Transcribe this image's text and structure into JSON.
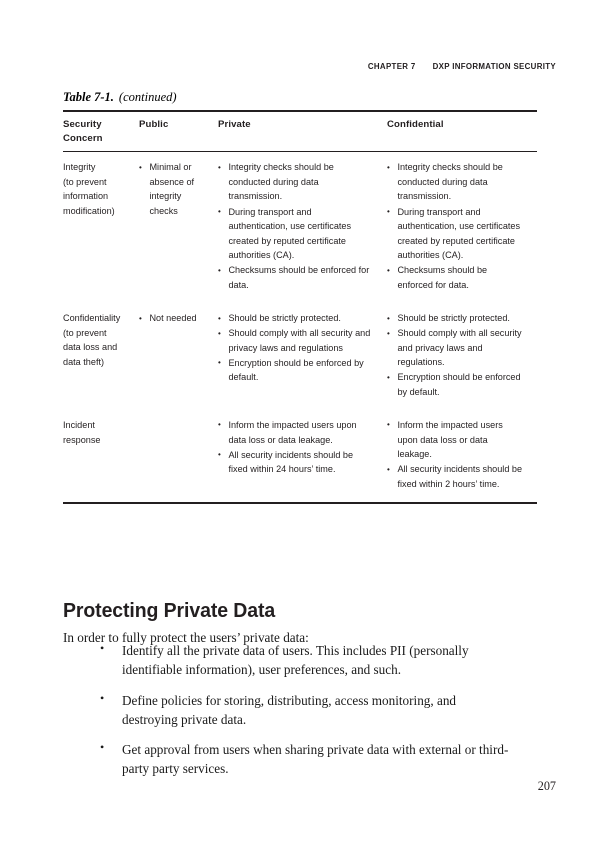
{
  "running_head": {
    "chapter": "CHAPTER 7",
    "title": "DXP INFORMATION SECURITY"
  },
  "table": {
    "caption_number": "Table 7-1.",
    "caption_continued": "(continued)",
    "columns": [
      {
        "label": "Security\nConcern",
        "line1": "Security",
        "line2": "Concern"
      },
      {
        "label": "Public"
      },
      {
        "label": "Private"
      },
      {
        "label": "Confidential"
      }
    ],
    "rows": [
      {
        "concern_lines": [
          "Integrity",
          "(to prevent",
          "information",
          "modification)"
        ],
        "public": [
          "Minimal or absence of integrity checks"
        ],
        "private": [
          "Integrity checks should be conducted during data transmission.",
          "During transport and authentication, use certificates created by reputed certificate authorities (CA).",
          "Checksums should be enforced for data."
        ],
        "confidential": [
          "Integrity checks should be conducted during data transmission.",
          "During transport and authentication, use certificates created by reputed certificate authorities (CA).",
          "Checksums should be enforced for data."
        ]
      },
      {
        "concern_lines": [
          "Confidentiality",
          "(to prevent",
          "data loss and",
          "data theft)"
        ],
        "public": [
          "Not needed"
        ],
        "private": [
          "Should be strictly protected.",
          "Should comply with all security and privacy laws and regulations",
          "Encryption should be enforced by default."
        ],
        "confidential": [
          "Should be strictly protected.",
          "Should comply with all security and privacy laws and regulations.",
          "Encryption should be enforced by default."
        ]
      },
      {
        "concern_lines": [
          "Incident",
          "response"
        ],
        "public": [],
        "private": [
          "Inform the impacted users upon data loss or data leakage.",
          "All security incidents should be fixed within 24 hours’ time."
        ],
        "confidential": [
          "Inform the impacted users upon data loss or data leakage.",
          "All security incidents should be fixed within 2 hours’ time."
        ]
      }
    ]
  },
  "section": {
    "heading": "Protecting Private Data",
    "intro": "In order to fully protect the users’ private data:",
    "bullets": [
      "Identify all the private data of users. This includes PII (personally identifiable information), user preferences, and such.",
      "Define policies for storing, distributing, access monitoring, and destroying private data.",
      "Get approval from users when sharing private data with external or third-party party services."
    ]
  },
  "folio": "207"
}
